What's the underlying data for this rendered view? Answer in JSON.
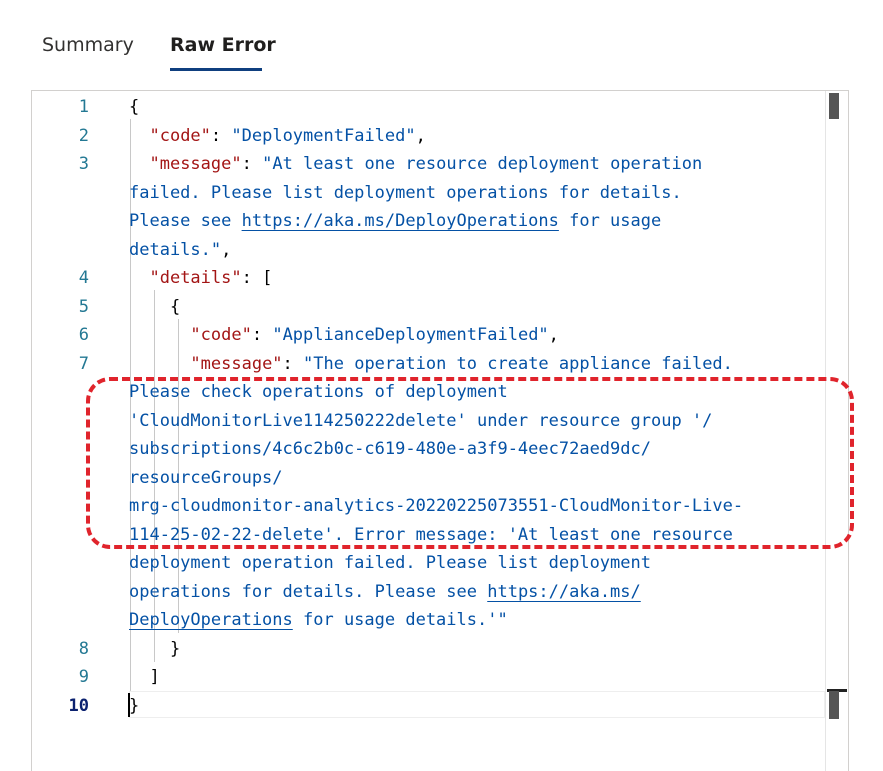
{
  "tabs": [
    {
      "label": "Summary",
      "active": false
    },
    {
      "label": "Raw Error",
      "active": true
    }
  ],
  "editor": {
    "line_numbers": [
      "1",
      "2",
      "3",
      "4",
      "5",
      "6",
      "7",
      "8",
      "9",
      "10"
    ],
    "lines": {
      "l1": "{",
      "l2_key": "\"code\"",
      "l2_colon": ": ",
      "l2_val": "\"DeploymentFailed\"",
      "l2_end": ",",
      "l3_key": "\"message\"",
      "l3_colon": ": ",
      "l3_val_a": "\"At least one resource deployment operation",
      "l3_val_b": "failed. Please list deployment operations for details.",
      "l3_val_c1": "Please see ",
      "l3_link": "https://aka.ms/DeployOperations",
      "l3_val_c2": " for usage",
      "l3_val_d": "details.\"",
      "l3_end": ",",
      "l4_key": "\"details\"",
      "l4_rest": ": [",
      "l5": "{",
      "l6_key": "\"code\"",
      "l6_colon": ": ",
      "l6_val": "\"ApplianceDeploymentFailed\"",
      "l6_end": ",",
      "l7_key": "\"message\"",
      "l7_colon": ": ",
      "l7_val_a": "\"The operation to create appliance failed.",
      "l7_val_b": "Please check operations of deployment",
      "l7_val_c": "'CloudMonitorLive114250222delete' under resource group '/",
      "l7_val_d": "subscriptions/4c6c2b0c-c619-480e-a3f9-4eec72aed9dc/",
      "l7_val_e": "resourceGroups/",
      "l7_val_f": "mrg-cloudmonitor-analytics-20220225073551-CloudMonitor-Live-",
      "l7_val_g": "114-25-02-22-delete'. Error message: 'At least one resource",
      "l7_val_h": "deployment operation failed. Please list deployment",
      "l7_val_i1": "operations for details. Please see ",
      "l7_link_a": "https://aka.ms/",
      "l7_link_b": "DeployOperations",
      "l7_val_j": " for usage details.'\"",
      "l8": "}",
      "l9": "]",
      "l10": "}"
    }
  },
  "annotation": {
    "color": "#e0242c",
    "style": "dashed-rounded-rect"
  }
}
